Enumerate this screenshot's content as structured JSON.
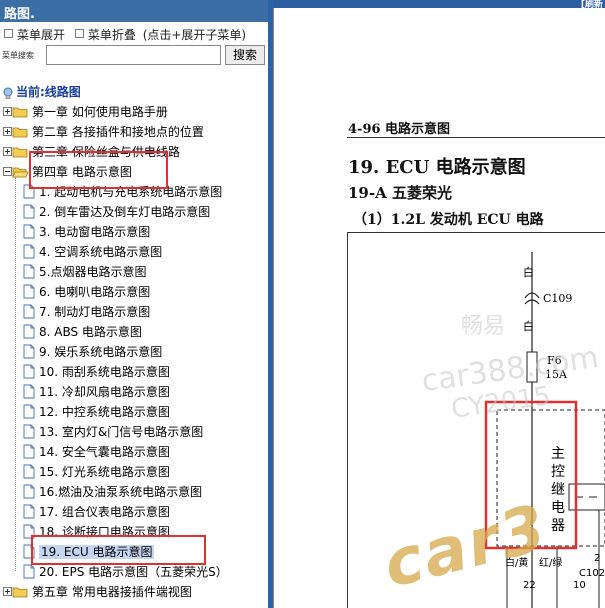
{
  "left_pane": {
    "header_title": "路图.",
    "menu_expand": "菜单展开",
    "menu_collapse": "菜单折叠",
    "menu_hint": "(点击+展开子菜单)",
    "search_label": "菜单搜索",
    "search_value": "",
    "search_button": "搜索",
    "current_location": "当前:线路图",
    "chapters": [
      {
        "label": "第一章 如何使用电路手册",
        "expanded": false
      },
      {
        "label": "第二章 各接插件和接地点的位置",
        "expanded": false
      },
      {
        "label": "第三章 保险丝盒与供电线路",
        "expanded": false
      },
      {
        "label": "第四章 电路示意图",
        "expanded": true
      },
      {
        "label": "第五章 常用电器接插件端视图",
        "expanded": false
      }
    ],
    "chapter4_items": [
      "1. 起动电机与充电系统电路示意图",
      "2. 倒车雷达及倒车灯电路示意图",
      "3. 电动窗电路示意图",
      "4. 空调系统电路示意图",
      "5.点烟器电路示意图",
      "6. 电喇叭电路示意图",
      "7. 制动灯电路示意图",
      "8. ABS 电路示意图",
      "9. 娱乐系统电路示意图",
      "10. 雨刮系统电路示意图",
      "11. 冷却风扇电路示意图",
      "12. 中控系统电路示意图",
      "13. 室内灯&门信号电路示意图",
      "14. 安全气囊电路示意图",
      "15. 灯光系统电路示意图",
      "16.燃油及油泵系统电路示意图",
      "17. 组合仪表电路示意图",
      "18. 诊断接口电路示意图",
      "19. ECU 电路示意图",
      "20. EPS 电路示意图（五菱荣光S）"
    ],
    "selected_index": 18
  },
  "document": {
    "top_right": "[刷新",
    "page_code": "4-96  电路示意图",
    "section_title": "19. ECU 电路示意图",
    "subsection_title": "19-A 五菱荣光",
    "sub_subsection_title": "（1）1.2L 发动机 ECU 电路",
    "diagram": {
      "wire_white_top": "白",
      "connector": "C109",
      "wire_white_mid": "白",
      "fuse_name": "F6",
      "fuse_rating": "15A",
      "relay_label": [
        "主",
        "控",
        "继",
        "电",
        "器"
      ],
      "wire_white_yellow": "白/黄",
      "wire_red_green": "红/绿",
      "pin_22": "22",
      "pin_10": "10",
      "connector_2": "C102",
      "right_small_2": "2"
    },
    "watermarks": [
      "畅易",
      "car388.com",
      "CY2015",
      "car3"
    ]
  },
  "colors": {
    "header_blue": "#3a6ea5",
    "divider_blue": "#2c63a8",
    "highlight_red": "#e03030",
    "location_blue": "#1a3fa0",
    "selected_bg": "#c6d6f2"
  }
}
